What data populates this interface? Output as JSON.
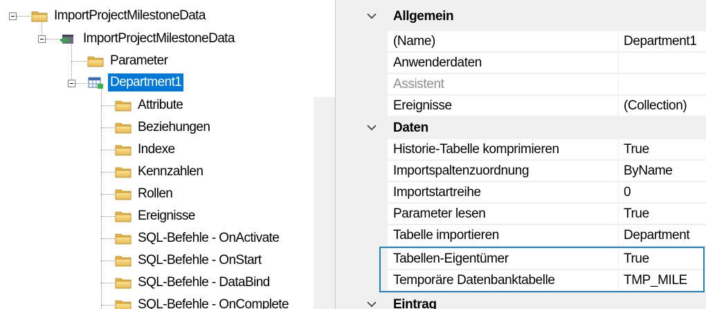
{
  "tree": {
    "root": {
      "label": "ImportProjectMilestoneData"
    },
    "process": {
      "label": "ImportProjectMilestoneData"
    },
    "parameter": {
      "label": "Parameter"
    },
    "department": {
      "label": "Department1"
    },
    "children": [
      {
        "label": "Attribute"
      },
      {
        "label": "Beziehungen"
      },
      {
        "label": "Indexe"
      },
      {
        "label": "Kennzahlen"
      },
      {
        "label": "Rollen"
      },
      {
        "label": "Ereignisse"
      },
      {
        "label": "SQL-Befehle - OnActivate"
      },
      {
        "label": "SQL-Befehle - OnStart"
      },
      {
        "label": "SQL-Befehle - DataBind"
      },
      {
        "label": "SQL-Befehle - OnComplete"
      }
    ]
  },
  "properties": {
    "categories": {
      "allgemein": "Allgemein",
      "daten": "Daten",
      "eintrag": "Eintrag"
    },
    "allgemein_rows": [
      {
        "name": "(Name)",
        "value": "Department1"
      },
      {
        "name": "Anwenderdaten",
        "value": ""
      },
      {
        "name": "Assistent",
        "value": ""
      },
      {
        "name": "Ereignisse",
        "value": "(Collection)"
      }
    ],
    "daten_rows": [
      {
        "name": "Historie-Tabelle komprimieren",
        "value": "True"
      },
      {
        "name": "Importspaltenzuordnung",
        "value": "ByName"
      },
      {
        "name": "Importstartreihe",
        "value": "0"
      },
      {
        "name": "Parameter lesen",
        "value": "True"
      },
      {
        "name": "Tabelle importieren",
        "value": "Department"
      },
      {
        "name": "Tabellen-Eigentümer",
        "value": "True"
      },
      {
        "name": "Temporäre Datenbanktabelle",
        "value": "TMP_MILE"
      }
    ]
  },
  "colors": {
    "selection": "#0078d7",
    "highlight_border": "#1f7fb6",
    "folder": "#f5d26b"
  }
}
